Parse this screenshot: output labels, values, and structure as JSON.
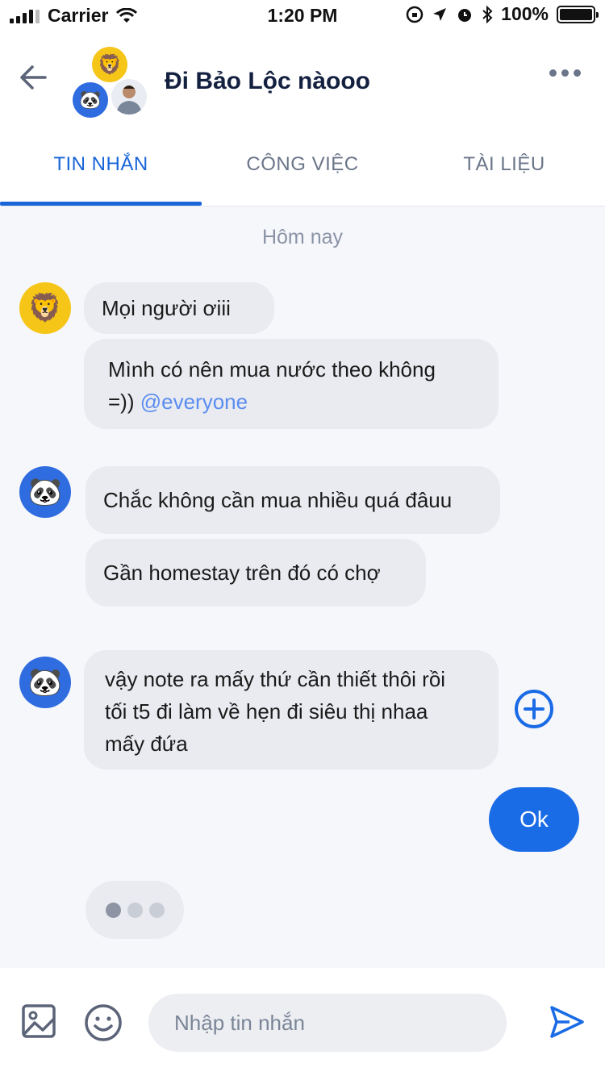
{
  "status_bar": {
    "carrier": "Carrier",
    "time": "1:20 PM",
    "battery": "100%",
    "battery_level": 1.0,
    "icons": [
      "signal-icon",
      "wifi-icon",
      "orientation-lock-icon",
      "location-icon",
      "alarm-icon",
      "bluetooth-icon",
      "battery-icon"
    ]
  },
  "header": {
    "title": "Đi Bảo Lộc nàooo",
    "back_icon": "arrow-left-icon",
    "more_icon": "more-horizontal-icon",
    "group_avatars": [
      {
        "icon": "lion-emoji",
        "glyph": "🦁",
        "color": "#f5c518"
      },
      {
        "icon": "panda-emoji",
        "glyph": "🐼",
        "color": "#2f6ce0"
      },
      {
        "icon": "person-photo",
        "color": "#e9ecf2"
      }
    ]
  },
  "tabs": [
    {
      "label": "TIN NHẮN",
      "active": true
    },
    {
      "label": "CÔNG VIỆC",
      "active": false
    },
    {
      "label": "TÀI LIỆU",
      "active": false
    }
  ],
  "chat": {
    "date_separator": "Hôm nay",
    "groups": [
      {
        "sender_avatar": {
          "icon": "lion-emoji",
          "glyph": "🦁"
        },
        "messages": [
          {
            "text": "Mọi người ơiii"
          },
          {
            "text": "Mình có nên mua nước theo không",
            "text2": "=))",
            "mention": "@everyone"
          }
        ]
      },
      {
        "sender_avatar": {
          "icon": "panda-emoji",
          "glyph": "🐼"
        },
        "messages": [
          {
            "text": "Chắc không cần mua nhiều quá đâuu"
          },
          {
            "text": "Gần homestay trên đó có chợ"
          }
        ]
      },
      {
        "sender_avatar": {
          "icon": "panda-emoji",
          "glyph": "🐼"
        },
        "messages": [
          {
            "lines": [
              "vậy note ra mấy thứ cần thiết thôi rồi",
              "tối t5 đi làm về hẹn đi siêu thị nhaa",
              "mấy đứa"
            ]
          }
        ]
      }
    ],
    "outgoing": [
      {
        "text": "Ok"
      }
    ],
    "typing_indicator": true,
    "react_icon": "plus-circle-icon"
  },
  "composer": {
    "placeholder": "Nhập tin nhắn",
    "value": "",
    "icons": [
      "image-icon",
      "emoji-smile-icon",
      "send-icon"
    ]
  },
  "colors": {
    "accent": "#1a66d9",
    "outgoing_bubble": "#1a6be6",
    "incoming_bubble": "#e9ebf0",
    "background": "#f6f7fb",
    "title": "#142040",
    "mention": "#5a8df0"
  }
}
